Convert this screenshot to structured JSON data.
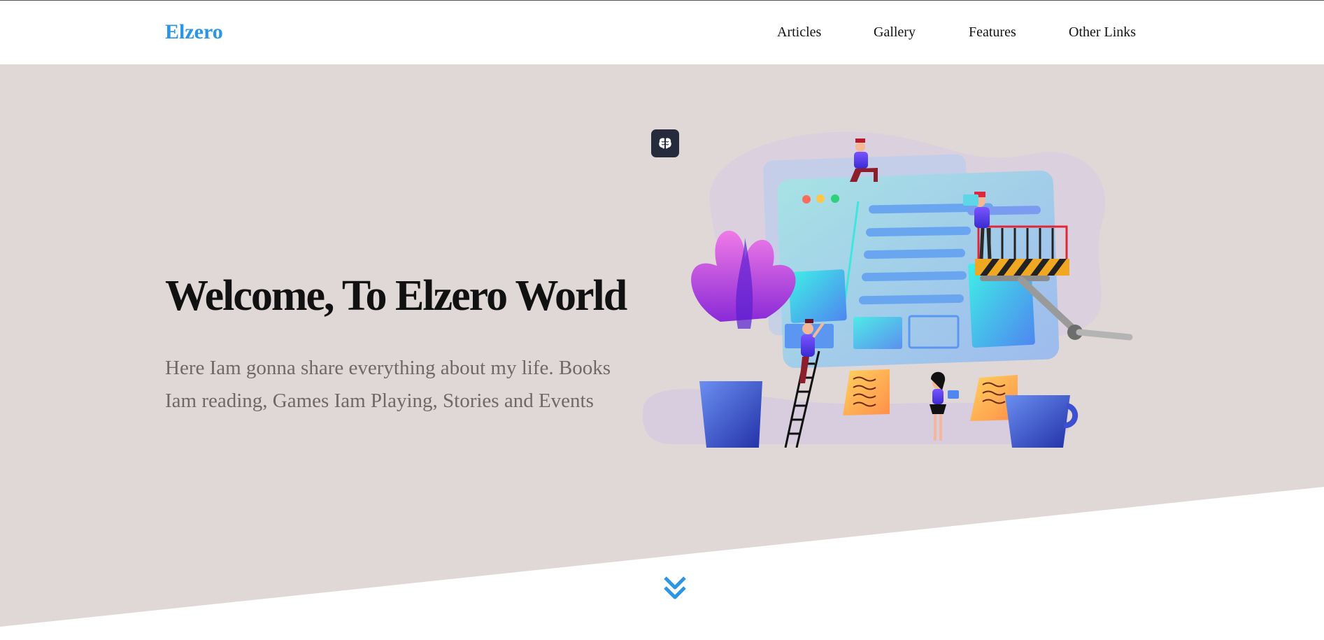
{
  "header": {
    "logo": "Elzero",
    "nav": [
      {
        "label": "Articles"
      },
      {
        "label": "Gallery"
      },
      {
        "label": "Features"
      },
      {
        "label": "Other Links"
      }
    ]
  },
  "hero": {
    "title": "Welcome, To Elzero World",
    "description": "Here Iam gonna share everything about my life. Books Iam reading, Games Iam Playing, Stories and Events"
  },
  "icons": {
    "badge": "brain-icon",
    "scroll": "double-chevron-down-icon"
  },
  "colors": {
    "brand": "#2b96e6",
    "hero_background": "#e0d8d7",
    "text_dark": "#111111",
    "text_muted": "#6e6969",
    "badge_background": "#252a3c"
  }
}
